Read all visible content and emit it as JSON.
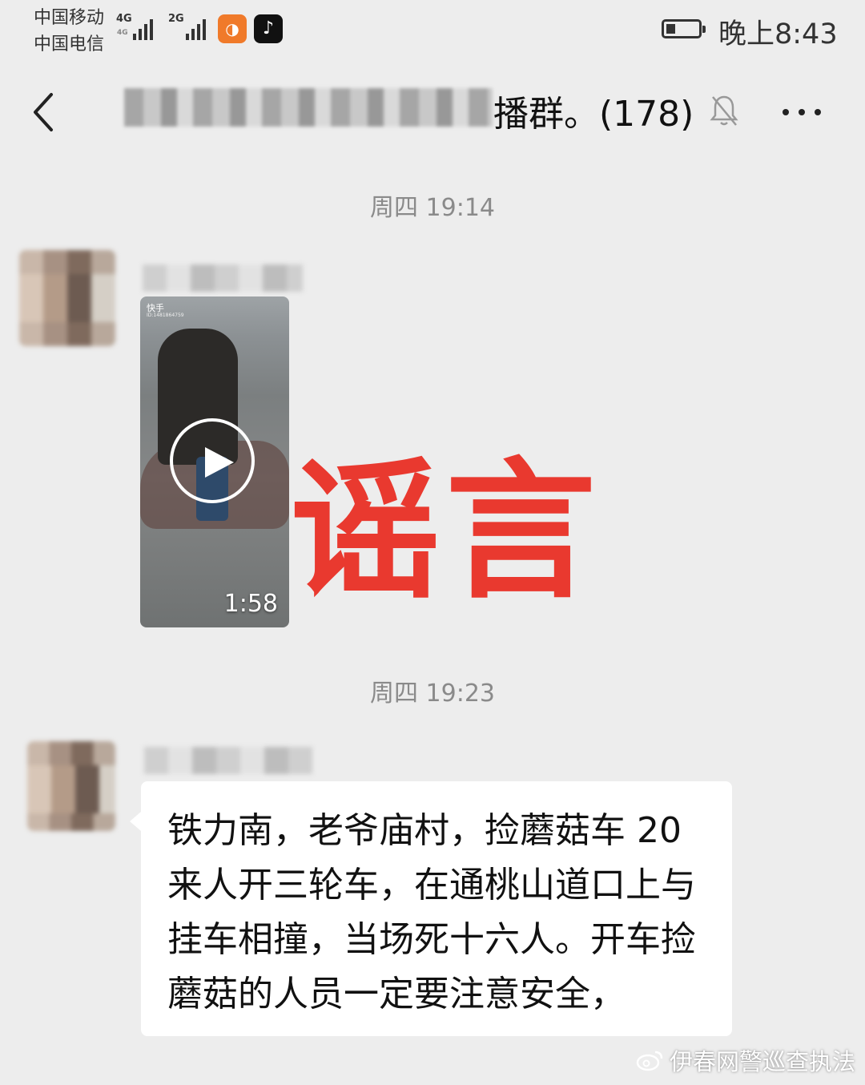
{
  "status_bar": {
    "carrier1": "中国移动",
    "carrier2": "中国电信",
    "net1": "4G",
    "net2": "2G",
    "net2_small": "4G",
    "time": "晚上8:43",
    "battery_level": 0.3,
    "apps": [
      "uc-browser-icon",
      "tiktok-icon"
    ]
  },
  "nav": {
    "title_visible": "播群。(178)",
    "muted": true
  },
  "messages": [
    {
      "time": "周四 19:14",
      "type": "video",
      "video": {
        "watermark": "快手",
        "watermark_id": "ID:1481864759",
        "duration": "1:58"
      }
    },
    {
      "time": "周四 19:23",
      "type": "text",
      "text": "铁力南，老爷庙村，捡蘑菇车 20来人开三轮车，在通桃山道口上与挂车相撞，当场死十六人。开车捡蘑菇的人员一定要注意安全，"
    }
  ],
  "stamp": "谣言",
  "watermark": "伊春网警巡查执法",
  "colors": {
    "background": "#ededed",
    "stamp": "#e9392f",
    "bubble": "#ffffff"
  }
}
